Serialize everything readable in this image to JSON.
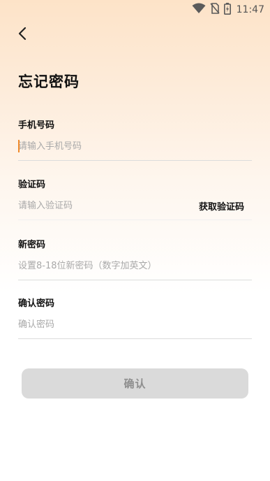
{
  "status_bar": {
    "time": "11:47",
    "icons": [
      "wifi-icon",
      "no-sim-icon",
      "battery-charging-icon"
    ]
  },
  "header": {
    "back_icon": "chevron-left-icon",
    "title": "忘记密码"
  },
  "form": {
    "phone": {
      "label": "手机号码",
      "placeholder": "请输入手机号码",
      "value": ""
    },
    "code": {
      "label": "验证码",
      "placeholder": "请输入验证码",
      "value": "",
      "get_code_label": "获取验证码"
    },
    "new_password": {
      "label": "新密码",
      "placeholder": "设置8-18位新密码（数字加英文）",
      "value": ""
    },
    "confirm_password": {
      "label": "确认密码",
      "placeholder": "确认密码",
      "value": ""
    },
    "submit_label": "确认"
  },
  "colors": {
    "accent_caret": "#f08a2a",
    "button_disabled_bg": "#dadada",
    "button_disabled_text": "#8e8e8e"
  }
}
